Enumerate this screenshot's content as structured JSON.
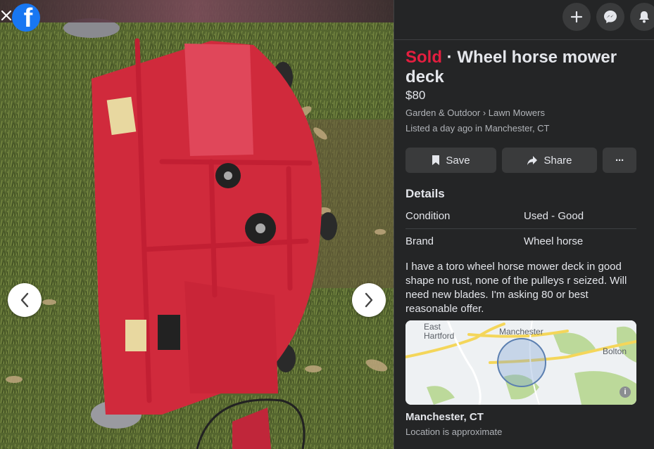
{
  "viewer": {
    "close_icon": "close-icon",
    "logo_icon": "facebook-logo-icon",
    "logo_glyph": "f",
    "prev_icon": "chevron-left-icon",
    "next_icon": "chevron-right-icon"
  },
  "top_actions": [
    {
      "name": "create-button",
      "icon": "plus-icon"
    },
    {
      "name": "messenger-button",
      "icon": "messenger-icon"
    },
    {
      "name": "notifications-button",
      "icon": "bell-icon"
    }
  ],
  "listing": {
    "status": "Sold",
    "separator": " · ",
    "title": "Wheel horse mower deck",
    "price": "$80",
    "breadcrumb": [
      "Garden & Outdoor",
      "Lawn Mowers"
    ],
    "breadcrumb_sep": " › ",
    "listed": "Listed a day ago in Manchester, CT",
    "colors": {
      "sold": "#e41e3f",
      "accent": "#1877f2"
    }
  },
  "actions": {
    "save_label": "Save",
    "share_label": "Share",
    "more_label": "···"
  },
  "details": {
    "heading": "Details",
    "rows": [
      {
        "label": "Condition",
        "value": "Used - Good"
      },
      {
        "label": "Brand",
        "value": "Wheel horse"
      }
    ],
    "description": "I have a toro wheel horse mower deck in good shape no rust, none of the pulleys r seized. Will need new blades. I'm asking 80 or best reasonable offer."
  },
  "map": {
    "labels": [
      "East Hartford",
      "Manchester",
      "Bolton"
    ],
    "info_icon": "info-icon",
    "info_glyph": "i"
  },
  "location": {
    "name": "Manchester, CT",
    "note": "Location is approximate"
  }
}
